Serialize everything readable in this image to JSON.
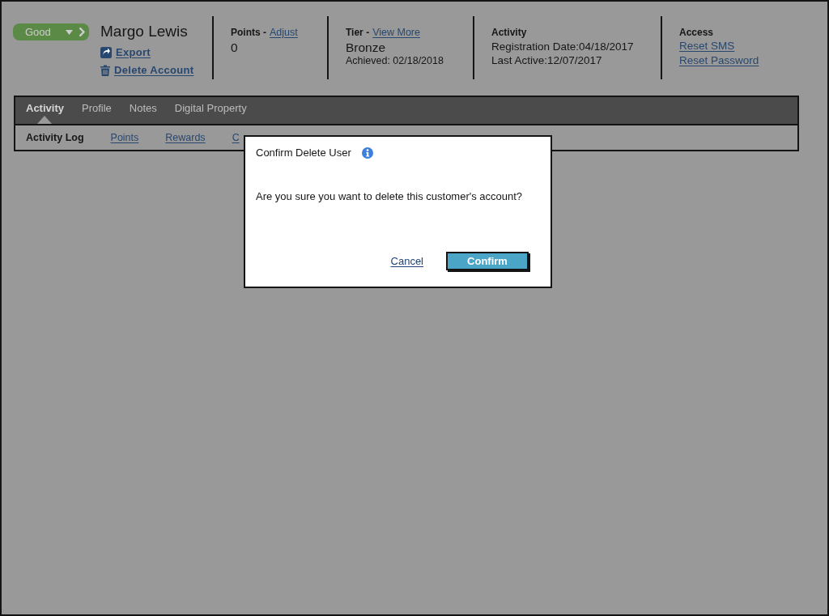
{
  "customer": {
    "status": {
      "label": "Good"
    },
    "name": "Margo Lewis",
    "actions": [
      {
        "kind": "export",
        "label": "Export"
      },
      {
        "kind": "delete",
        "label": "Delete Account"
      }
    ]
  },
  "summary": [
    {
      "title": "Points -",
      "link": "Adjust",
      "value": "0"
    },
    {
      "title": "Tier -",
      "link": "View More",
      "value": "Bronze",
      "detail": "Achieved: 02/18/2018"
    },
    {
      "title": "Activity",
      "lines": [
        "Registration Date:04/18/2017",
        "Last Active:12/07/2017"
      ]
    },
    {
      "title": "Access",
      "links": [
        "Reset SMS",
        "Reset Password"
      ]
    }
  ],
  "tabs": [
    {
      "label": "Activity",
      "selected": true
    },
    {
      "label": "Profile",
      "selected": false
    },
    {
      "label": "Notes",
      "selected": false
    },
    {
      "label": "Digital Property",
      "selected": false
    }
  ],
  "subtabs": [
    {
      "label": "Activity Log",
      "selected": true
    },
    {
      "label": "Points",
      "selected": false
    },
    {
      "label": "Rewards",
      "selected": false
    },
    {
      "label": "C",
      "selected": false
    }
  ],
  "dialog": {
    "title": "Confirm Delete User",
    "message": "Are you sure you want to delete this customer's account?",
    "buttons": [
      {
        "kind": "link",
        "label": "Cancel"
      },
      {
        "kind": "primary",
        "label": "Confirm"
      }
    ]
  }
}
